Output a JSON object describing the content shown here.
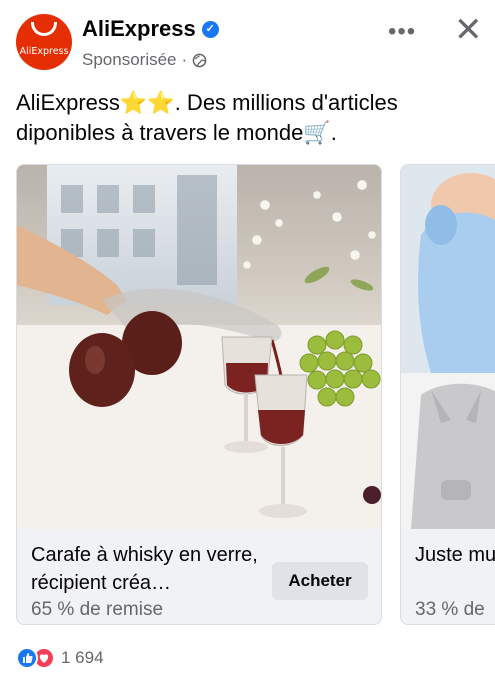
{
  "header": {
    "page_name": "AliExpress",
    "avatar_text": "AliExpress",
    "sponsored": "Sponsorisée",
    "separator": "·",
    "more_label": "•••",
    "close_label": "✕"
  },
  "post": {
    "text_line1": "AliExpress⭐⭐. Des millions d'articles",
    "text_line2": "diponibles à travers le monde🛒."
  },
  "cards": [
    {
      "title": "Carafe à whisky en verre, récipient créa…",
      "discount": "65 % de remise",
      "button": "Acheter"
    },
    {
      "title": "Juste multifon",
      "discount": "33 % de"
    }
  ],
  "reactions": {
    "count": "1 694"
  },
  "colors": {
    "brand": "#e62e04",
    "facebook_blue": "#1877f2",
    "love_red": "#f33e58",
    "secondary_text": "#65676b"
  },
  "icons": [
    "verified-badge-icon",
    "globe-icon",
    "more-options-icon",
    "close-icon",
    "like-reaction-icon",
    "love-reaction-icon"
  ]
}
